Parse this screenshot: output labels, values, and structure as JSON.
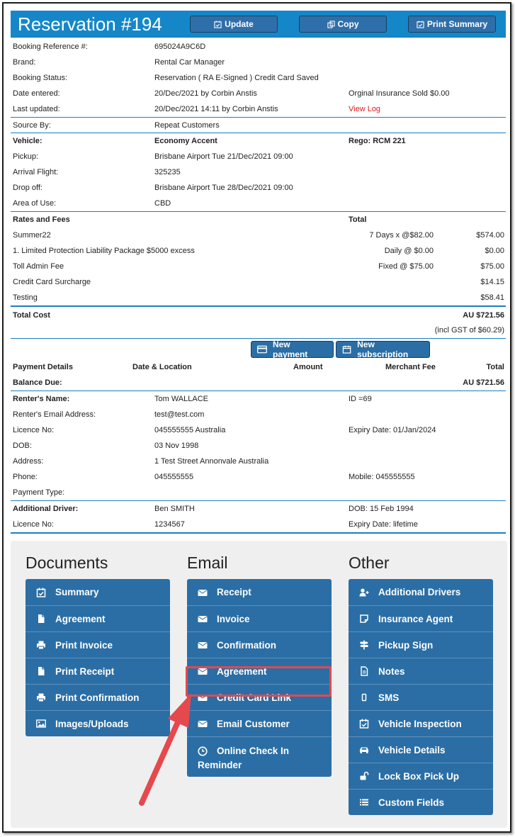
{
  "header": {
    "title": "Reservation #194",
    "update_label": "Update",
    "copy_label": "Copy",
    "print_summary_label": "Print Summary"
  },
  "booking": {
    "reference_label": "Booking Reference #:",
    "reference": "695024A9C6D",
    "brand_label": "Brand:",
    "brand": "Rental Car Manager",
    "status_label": "Booking Status:",
    "status": "Reservation ( RA E-Signed ) Credit Card Saved",
    "entered_label": "Date entered:",
    "entered": "20/Dec/2021 by Corbin Anstis",
    "insurance": "Orginal Insurance Sold $0.00",
    "updated_label": "Last updated:",
    "updated": "20/Dec/2021 14:11 by Corbin Anstis",
    "view_log": "View Log",
    "source_label": "Source By:",
    "source": "Repeat Customers"
  },
  "vehicle": {
    "vehicle_label": "Vehicle:",
    "vehicle": "Economy Accent",
    "rego": "Rego: RCM 221",
    "pickup_label": "Pickup:",
    "pickup": "Brisbane Airport Tue 21/Dec/2021 09:00",
    "flight_label": "Arrival Flight:",
    "flight": "325235",
    "dropoff_label": "Drop off:",
    "dropoff": "Brisbane Airport Tue 28/Dec/2021 09:00",
    "area_label": "Area of Use:",
    "area": "CBD"
  },
  "rates": {
    "heading": "Rates and Fees",
    "total_heading": "Total",
    "items": [
      {
        "name": "Summer22",
        "rate": "7 Days x @$82.00",
        "amount": "$574.00"
      },
      {
        "name": "1. Limited Protection Liability Package $5000 excess",
        "rate": "Daily @ $0.00",
        "amount": "$0.00"
      },
      {
        "name": "Toll Admin Fee",
        "rate": "Fixed @ $75.00",
        "amount": "$75.00"
      },
      {
        "name": "Credit Card Surcharge",
        "rate": "",
        "amount": "$14.15"
      },
      {
        "name": "Testing",
        "rate": "",
        "amount": "$58.41"
      }
    ],
    "total_cost_label": "Total Cost",
    "total_cost": "AU $721.56",
    "gst": "(incl GST of $60.29)"
  },
  "payments": {
    "new_payment": "New payment",
    "new_subscription": "New subscription",
    "col_details": "Payment Details",
    "col_date": "Date & Location",
    "col_amount": "Amount",
    "col_fee": "Merchant Fee",
    "col_total": "Total",
    "balance_label": "Balance Due:",
    "balance": "AU $721.56"
  },
  "renter": {
    "name_label": "Renter's Name:",
    "name": "Tom WALLACE",
    "id": "ID =69",
    "email_label": "Renter's Email Address:",
    "email": "test@test.com",
    "licence_label": "Licence No:",
    "licence": "045555555 Australia",
    "expiry": "Expiry Date: 01/Jan/2024",
    "dob_label": "DOB:",
    "dob": "03 Nov 1998",
    "address_label": "Address:",
    "address": "1 Test Street Annonvale Australia",
    "phone_label": "Phone:",
    "phone": "045555555",
    "mobile": "Mobile: 045555555",
    "payment_type_label": "Payment Type:"
  },
  "driver": {
    "label": "Additional Driver:",
    "name": "Ben SMITH",
    "dob": "DOB: 15 Feb 1994",
    "licence_label": "Licence No:",
    "licence": "1234567",
    "expiry": "Expiry Date: lifetime"
  },
  "documents": {
    "heading": "Documents",
    "items": [
      "Summary",
      "Agreement",
      "Print Invoice",
      "Print Receipt",
      "Print Confirmation",
      "Images/Uploads"
    ]
  },
  "email": {
    "heading": "Email",
    "items": [
      "Receipt",
      "Invoice",
      "Confirmation",
      "Agreement",
      "Credit Card Link",
      "Email Customer"
    ],
    "reminder_line1": "Online Check In",
    "reminder_line2": "Reminder"
  },
  "other": {
    "heading": "Other",
    "items": [
      "Additional Drivers",
      "Insurance Agent",
      "Pickup Sign",
      "Notes",
      "SMS",
      "Vehicle Inspection",
      "Vehicle Details",
      "Lock Box Pick Up",
      "Custom Fields"
    ]
  },
  "colors": {
    "header_blue": "#1587c8",
    "button_blue": "#2a6ea5",
    "highlight_red": "#e5484d",
    "link_red": "#e01b1b"
  }
}
